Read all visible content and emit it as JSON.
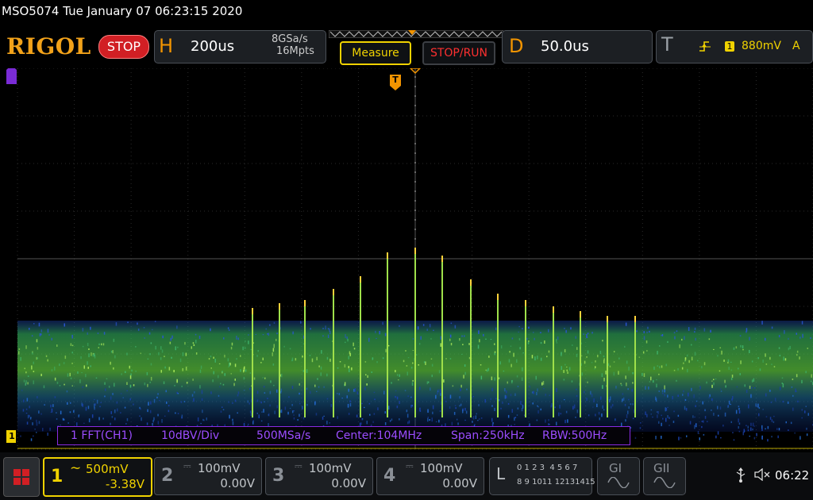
{
  "header": {
    "model_datetime": "MSO5074  Tue January 07 06:23:15 2020",
    "brand": "RIGOL",
    "run_state": "STOP"
  },
  "horizontal": {
    "letter": "H",
    "timebase": "200us",
    "sample_rate": "8GSa/s",
    "memory_depth": "16Mpts"
  },
  "buttons": {
    "measure": "Measure",
    "stop_run": "STOP/RUN"
  },
  "delay": {
    "letter": "D",
    "value": "50.0us"
  },
  "trigger": {
    "letter": "T",
    "channel": "1",
    "level": "880mV",
    "mode": "A",
    "edge_icon": "rising-edge-icon"
  },
  "display": {
    "trigger_marker": "T",
    "channel_marker": "1",
    "fft": {
      "label": "1 FFT(CH1)",
      "scale": "10dBV/Div",
      "rate": "500MSa/s",
      "center": "Center:104MHz",
      "span": "Span:250kHz",
      "rbw": "RBW:500Hz"
    }
  },
  "channels": [
    {
      "num": "1",
      "scale": "500mV",
      "offset": "-3.38V",
      "color": "#f0d200",
      "coupling_icon": "ac-coupling-icon"
    },
    {
      "num": "2",
      "scale": "100mV",
      "offset": "0.00V",
      "color": "#8a8f96",
      "coupling_icon": "dc-coupling-icon"
    },
    {
      "num": "3",
      "scale": "100mV",
      "offset": "0.00V",
      "color": "#8a8f96",
      "coupling_icon": "dc-coupling-icon"
    },
    {
      "num": "4",
      "scale": "100mV",
      "offset": "0.00V",
      "color": "#8a8f96",
      "coupling_icon": "dc-coupling-icon"
    }
  ],
  "logic": {
    "letter": "L",
    "row1": "0 1 2 3  4 5 6 7",
    "row2": "8 9 1011 12131415"
  },
  "generators": [
    "GI",
    "GII"
  ],
  "status": {
    "time": "06:22"
  },
  "colors": {
    "accent_orange": "#f29400",
    "channel1_yellow": "#f0d200",
    "fft_purple": "#9b4dff",
    "stop_red": "#d11f24"
  }
}
